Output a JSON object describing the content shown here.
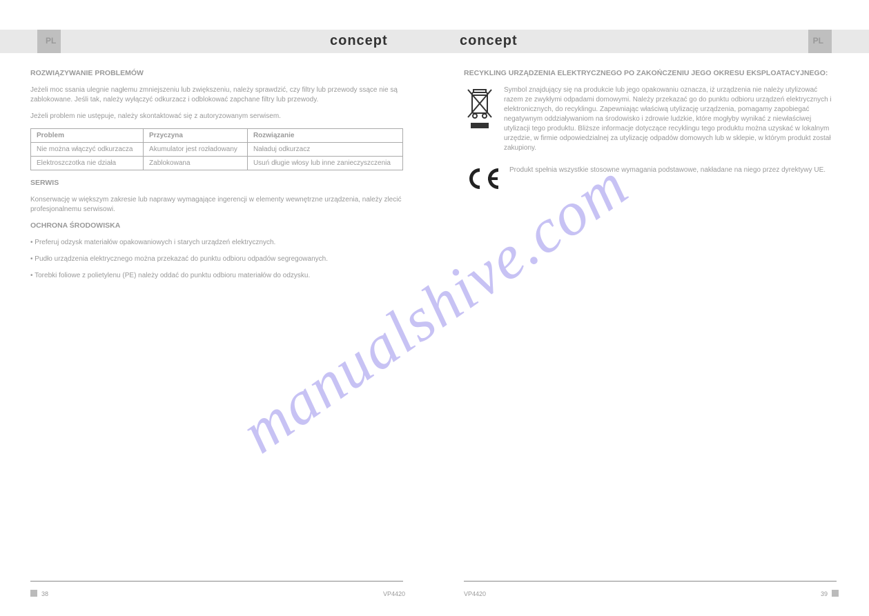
{
  "header": {
    "brand": "concept",
    "lang_left": "PL",
    "lang_right": "PL"
  },
  "left": {
    "section1_title": "ROZWIĄZYWANIE PROBLEMÓW",
    "section1_p1": "Jeżeli moc ssania ulegnie nagłemu zmniejszeniu lub zwiększeniu, należy sprawdzić, czy filtry lub przewody ssące nie są zablokowane. Jeśli tak, należy wyłączyć odkurzacz i odblokować zapchane filtry lub przewody.",
    "section1_p2": "Jeżeli problem nie ustępuje, należy skontaktować się z autoryzowanym serwisem.",
    "table": [
      [
        "Problem",
        "Przyczyna",
        "Rozwiązanie"
      ],
      [
        "Nie można włączyć odkurzacza",
        "Akumulator jest rozładowany",
        "Naładuj odkurzacz"
      ],
      [
        "Elektroszczotka nie działa",
        "Zablokowana",
        "Usuń długie włosy lub inne zanieczyszczenia"
      ]
    ],
    "section2_title": "SERWIS",
    "section2_p1": "Konserwację w większym zakresie lub naprawy wymagające ingerencji w elementy wewnętrzne urządzenia, należy zlecić profesjonalnemu serwisowi.",
    "section3_title": "OCHRONA ŚRODOWISKA",
    "section3_items": [
      "Preferuj odzysk materiałów opakowaniowych i starych urządzeń elektrycznych.",
      "Pudło urządzenia elektrycznego można przekazać do punktu odbioru odpadów segregowanych.",
      "Torebki foliowe z polietylenu (PE) należy oddać do punktu odbioru materiałów do odzysku."
    ]
  },
  "right": {
    "section1_title": "RECYKLING URZĄDZENIA ELEKTRYCZNEGO PO ZAKOŃCZENIU JEGO OKRESU EKSPLOATACYJNEGO:",
    "section1_text": "Symbol znajdujący się na produkcie lub jego opakowaniu oznacza, iż urządzenia nie należy utylizować razem ze zwykłymi odpadami domowymi. Należy przekazać go do punktu odbioru urządzeń elektrycznych i elektronicznych, do recyklingu. Zapewniając właściwą utylizację urządzenia, pomagamy zapobiegać negatywnym oddziaływaniom na środowisko i zdrowie ludzkie, które mogłyby wynikać z niewłaściwej utylizacji tego produktu. Bliższe informacje dotyczące recyklingu tego produktu można uzyskać w lokalnym urzędzie, w firmie odpowiedzialnej za utylizację odpadów domowych lub w sklepie, w którym produkt został zakupiony.",
    "section2_text": "Produkt spełnia wszystkie stosowne wymagania podstawowe, nakładane na niego przez dyrektywy UE."
  },
  "footer": {
    "page_left": "38",
    "page_right": "39",
    "model": "VP4420"
  },
  "watermark": "manualshive.com"
}
